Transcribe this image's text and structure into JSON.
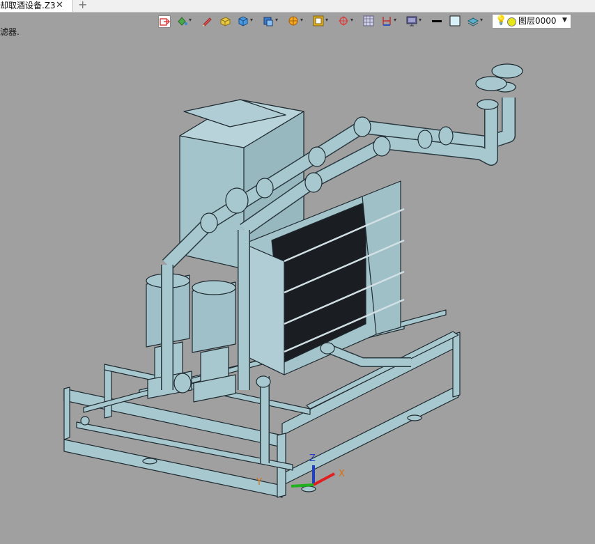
{
  "tabs": [
    {
      "label": "却取酒设备.Z3",
      "close_icon": "close-icon"
    }
  ],
  "new_tab_icon": "plus-icon",
  "side_label": "滤器.",
  "toolbar": {
    "buttons": [
      {
        "icon": "exit-icon",
        "color": "#d94040"
      },
      {
        "icon": "paint-bucket-icon",
        "color": "#40a040"
      },
      {
        "icon": "pencil-icon",
        "color": "#e05050"
      },
      {
        "icon": "box-icon",
        "color": "#e0c040"
      },
      {
        "icon": "cube-icon",
        "color": "#3a8ad8"
      },
      {
        "icon": "shaded-cube-icon",
        "color": "#3a7ac8"
      },
      {
        "icon": "sun-icon",
        "color": "#f0a020"
      },
      {
        "icon": "frame-icon",
        "color": "#e0b020"
      },
      {
        "icon": "axis-icon",
        "color": "#d84040"
      },
      {
        "icon": "grid-icon",
        "color": "#7070a0"
      },
      {
        "icon": "dimension-icon",
        "color": "#c03030"
      },
      {
        "icon": "monitor-icon",
        "color": "#606090"
      }
    ],
    "line_icon": "line-weight-icon",
    "color_icon": "color-swatch-icon",
    "layer_stack_icon": "layers-icon"
  },
  "layer": {
    "bulb_icon": "lightbulb-icon",
    "color": "#e6e619",
    "name": "图层0000"
  },
  "axes": {
    "x": "X",
    "y": "Y",
    "z": "Z"
  }
}
